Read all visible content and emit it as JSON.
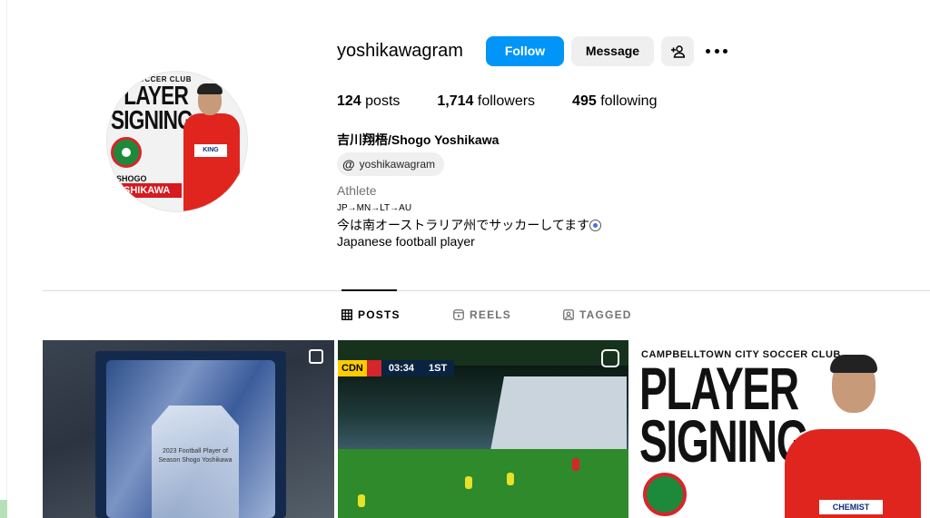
{
  "profile": {
    "username": "yoshikawagram",
    "full_name": "吉川翔梧/Shogo Yoshikawa",
    "threads_handle": "yoshikawagram",
    "category": "Athlete",
    "bio_line1": "JP→MN→LT→AU",
    "bio_line2": "今は南オーストラリア州でサッカーしてます",
    "bio_line3": "Japanese football player"
  },
  "actions": {
    "follow_label": "Follow",
    "message_label": "Message"
  },
  "stats": {
    "posts_count": "124",
    "posts_label": "posts",
    "followers_count": "1,714",
    "followers_label": "followers",
    "following_count": "495",
    "following_label": "following"
  },
  "avatar": {
    "club": "CITY SOCCER CLUB",
    "title": "PLAYER SIGNING",
    "name_line1": "SHOGO",
    "name_line2": "SHIKAWA",
    "sponsor": "KING"
  },
  "tabs": [
    {
      "label": "POSTS",
      "icon": "grid-icon",
      "active": true
    },
    {
      "label": "REELS",
      "icon": "reels-icon",
      "active": false
    },
    {
      "label": "TAGGED",
      "icon": "tagged-icon",
      "active": false
    }
  ],
  "posts": {
    "trophy_text": "2023 Football Player of Season Shogo Yoshikawa",
    "scoreboard": {
      "team": "CDN",
      "time": "03:34",
      "half": "1ST"
    },
    "signing_club": "CAMPBELLTOWN CITY SOCCER CLUB",
    "signing_title": "PLAYER SIGNING",
    "signing_sponsor": "CHEMIST"
  },
  "colors": {
    "accent": "#0095f6",
    "button_secondary": "#efefef",
    "muted_text": "#737373"
  }
}
